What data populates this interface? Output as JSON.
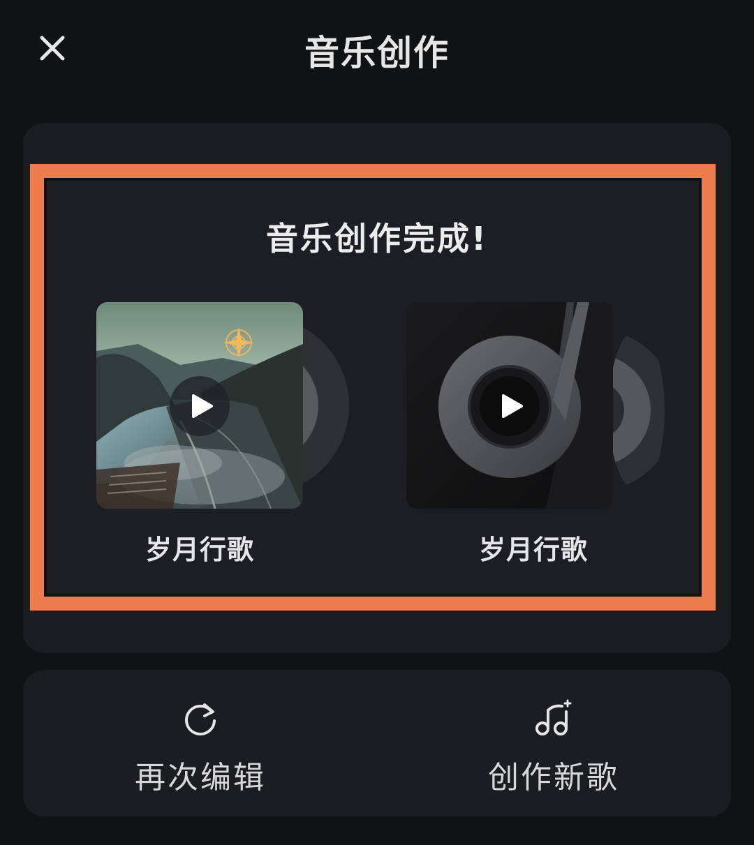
{
  "header": {
    "title": "音乐创作",
    "close_icon": "close-icon"
  },
  "result": {
    "title": "音乐创作完成!",
    "songs": [
      {
        "name": "岁月行歌",
        "cover": "landscape-road-sunset-cover",
        "play_icon": "play-icon"
      },
      {
        "name": "岁月行歌",
        "cover": "dark-vinyl-note-cover",
        "play_icon": "play-icon"
      }
    ]
  },
  "actions": {
    "edit_again": {
      "label": "再次编辑",
      "icon": "refresh-icon"
    },
    "create_new": {
      "label": "创作新歌",
      "icon": "music-notes-icon"
    }
  },
  "colors": {
    "background": "#111214",
    "card": "#1c1d21",
    "highlight": "#ee7d4d",
    "text": "#e9e9ea"
  }
}
